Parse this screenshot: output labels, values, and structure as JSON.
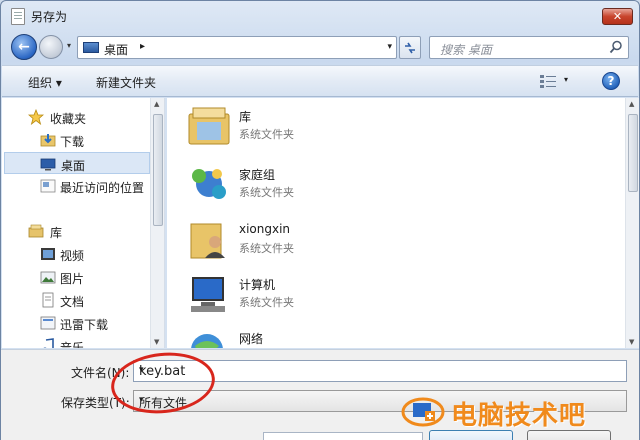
{
  "window": {
    "title": "另存为",
    "close_glyph": "✕"
  },
  "nav": {
    "back_glyph": "←",
    "address_text": "桌面",
    "address_arrow": "▸",
    "drop_glyph": "▾",
    "search_placeholder": "搜索 桌面"
  },
  "toolbar": {
    "organize_label": "组织 ▾",
    "new_folder_label": "新建文件夹",
    "help_glyph": "?",
    "view_drop": "▾"
  },
  "sidebar": {
    "items": [
      {
        "label": "收藏夹",
        "icon": "star-icon"
      },
      {
        "label": "下载",
        "icon": "download-folder-icon"
      },
      {
        "label": "桌面",
        "icon": "desktop-icon",
        "selected": true
      },
      {
        "label": "最近访问的位置",
        "icon": "recent-places-icon"
      },
      {
        "label": "库",
        "icon": "library-icon"
      },
      {
        "label": "视频",
        "icon": "video-icon"
      },
      {
        "label": "图片",
        "icon": "picture-icon"
      },
      {
        "label": "文档",
        "icon": "document-icon"
      },
      {
        "label": "迅雷下载",
        "icon": "thunder-download-icon"
      },
      {
        "label": "音乐",
        "icon": "music-icon"
      }
    ]
  },
  "files": [
    {
      "name": "库",
      "type": "系统文件夹",
      "icon": "library-folder-icon"
    },
    {
      "name": "家庭组",
      "type": "系统文件夹",
      "icon": "homegroup-icon"
    },
    {
      "name": "xiongxin",
      "type": "系统文件夹",
      "icon": "user-folder-icon"
    },
    {
      "name": "计算机",
      "type": "系统文件夹",
      "icon": "computer-icon"
    },
    {
      "name": "网络",
      "type": "",
      "icon": "network-icon"
    }
  ],
  "form": {
    "filename_label": "文件名(N):",
    "filename_value": "key.bat",
    "filetype_label": "保存类型(T):",
    "filetype_value": "所有文件"
  },
  "watermark": {
    "text": "电脑技术吧"
  },
  "colors": {
    "annotation": "#d8261c",
    "watermark": "#f08a1c",
    "selection": "#dbe7f6"
  }
}
